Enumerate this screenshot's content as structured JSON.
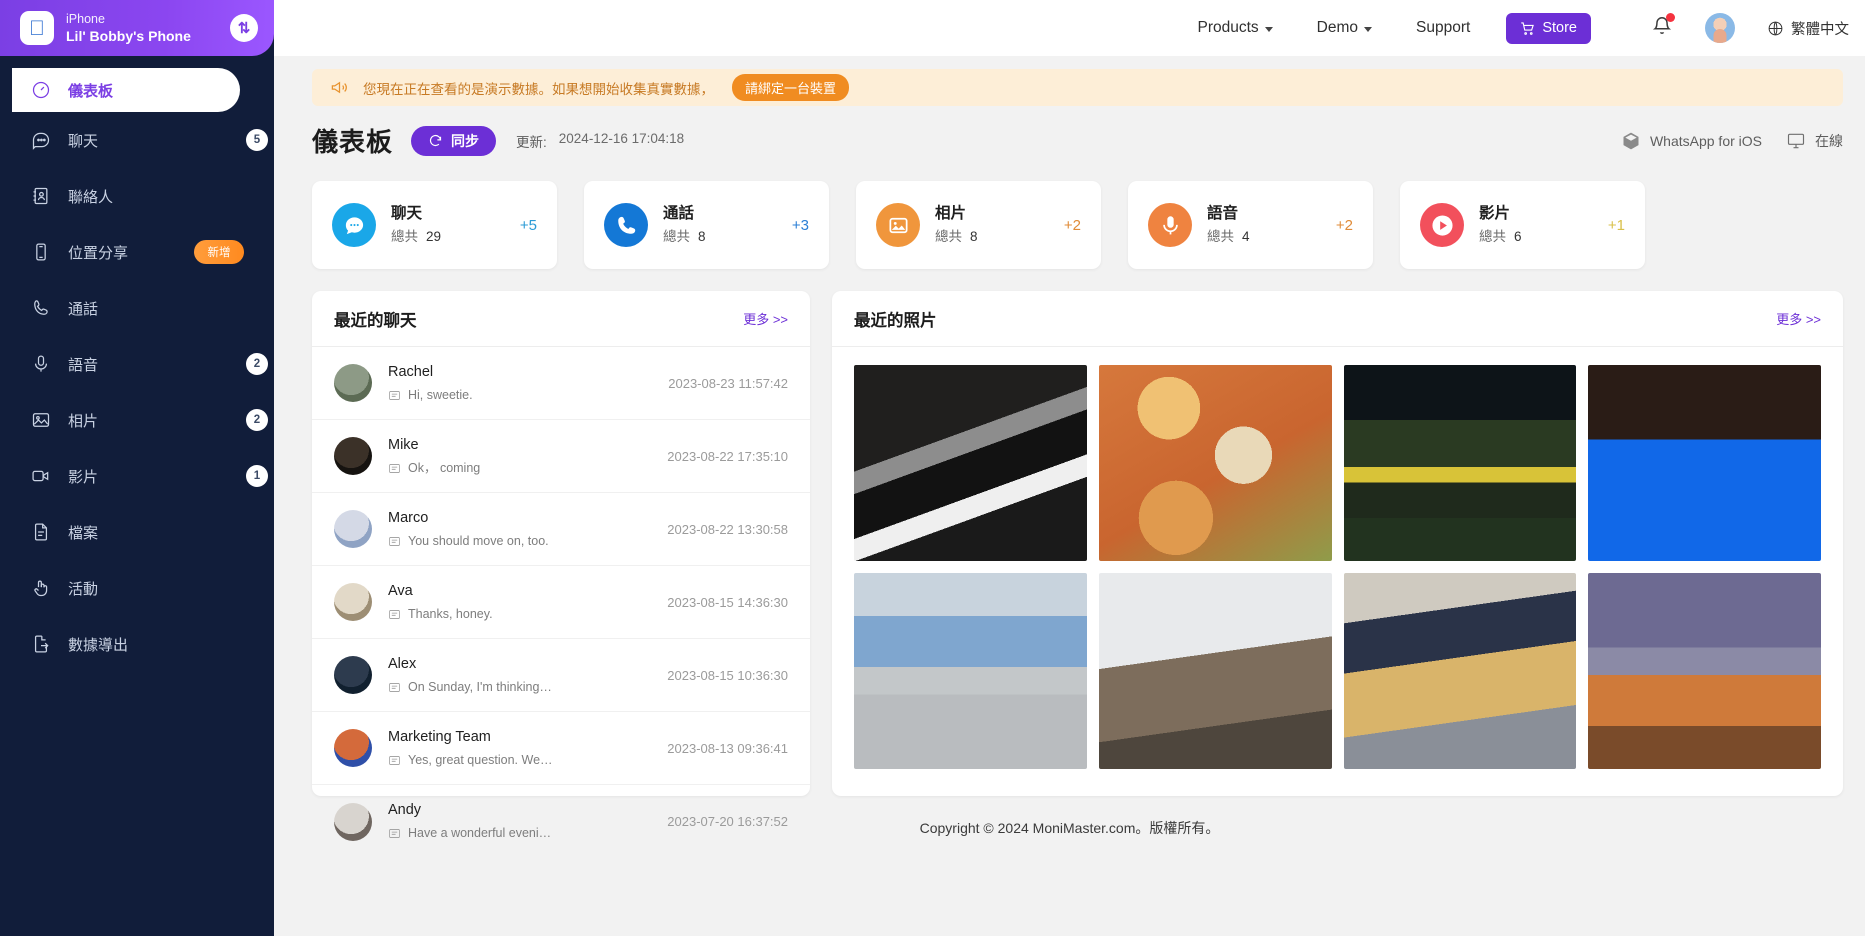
{
  "sidebar": {
    "device": {
      "platform": "iPhone",
      "name": "Lil' Bobby's Phone",
      "swap_icon": "swap-device-icon"
    },
    "items": [
      {
        "label": "儀表板",
        "icon": "dashboard-icon",
        "badge": "",
        "active": true
      },
      {
        "label": "聊天",
        "icon": "chat-bubble-icon",
        "badge": "5",
        "active": false
      },
      {
        "label": "聯絡人",
        "icon": "contacts-icon",
        "badge": "",
        "active": false
      },
      {
        "label": "位置分享",
        "icon": "phone-location-icon",
        "badge": "新增",
        "badge_type": "new",
        "active": false
      },
      {
        "label": "通話",
        "icon": "phone-call-icon",
        "badge": "",
        "active": false
      },
      {
        "label": "語音",
        "icon": "microphone-icon",
        "badge": "2",
        "active": false
      },
      {
        "label": "相片",
        "icon": "photo-icon",
        "badge": "2",
        "active": false
      },
      {
        "label": "影片",
        "icon": "video-camera-icon",
        "badge": "1",
        "active": false
      },
      {
        "label": "檔案",
        "icon": "file-icon",
        "badge": "",
        "active": false
      },
      {
        "label": "活動",
        "icon": "hand-pointer-icon",
        "badge": "",
        "active": false
      },
      {
        "label": "數據導出",
        "icon": "data-export-icon",
        "badge": "",
        "active": false
      }
    ]
  },
  "topnav": {
    "links": [
      {
        "label": "Products",
        "has_caret": true
      },
      {
        "label": "Demo",
        "has_caret": true
      },
      {
        "label": "Support",
        "has_caret": false
      }
    ],
    "store_label": "Store",
    "store_icon": "shopping-cart-icon",
    "bell_icon": "notification-bell-icon",
    "avatar_icon": "user-avatar",
    "lang_icon": "globe-icon",
    "lang_label": "繁體中文"
  },
  "notice": {
    "icon": "megaphone-icon",
    "text": "您現在正在查看的是演示數據。如果想開始收集真實數據，",
    "cta": "請綁定一台裝置"
  },
  "page": {
    "title": "儀表板",
    "sync_label": "同步",
    "sync_icon": "refresh-icon",
    "updated_label": "更新:",
    "updated_value": "2024-12-16 17:04:18",
    "app_icon": "cube-icon",
    "app_label": "WhatsApp for iOS",
    "status_icon": "monitor-icon",
    "status_label": "在線"
  },
  "stats": [
    {
      "name": "聊天",
      "total_label": "總共",
      "total": "29",
      "delta": "+5",
      "icon": "chat-bubble-icon",
      "color": "#1aa7e8",
      "delta_color": "#2b9bd6"
    },
    {
      "name": "通話",
      "total_label": "總共",
      "total": "8",
      "delta": "+3",
      "icon": "phone-call-icon",
      "color": "#1478d6",
      "delta_color": "#2b7fd6"
    },
    {
      "name": "相片",
      "total_label": "總共",
      "total": "8",
      "delta": "+2",
      "icon": "photo-icon",
      "color": "#f0963c",
      "delta_color": "#e08b38"
    },
    {
      "name": "語音",
      "total_label": "總共",
      "total": "4",
      "delta": "+2",
      "icon": "microphone-icon",
      "color": "#ef8340",
      "delta_color": "#e08b38"
    },
    {
      "name": "影片",
      "total_label": "總共",
      "total": "6",
      "delta": "+1",
      "icon": "play-icon",
      "color": "#f2505c",
      "delta_color": "#d9c14a"
    }
  ],
  "chats_panel": {
    "title": "最近的聊天",
    "more": "更多 >>",
    "rows": [
      {
        "name": "Rachel",
        "message": "Hi, sweetie.",
        "time": "2023-08-23 11:57:42",
        "avatar_colors": [
          "#8d9a86",
          "#5c6b54"
        ]
      },
      {
        "name": "Mike",
        "message": "Ok， coming",
        "time": "2023-08-22 17:35:10",
        "avatar_colors": [
          "#3b3128",
          "#161310"
        ]
      },
      {
        "name": "Marco",
        "message": "You should move on, too.",
        "time": "2023-08-22 13:30:58",
        "avatar_colors": [
          "#d4d9e6",
          "#8fa3c4"
        ]
      },
      {
        "name": "Ava",
        "message": "Thanks, honey.",
        "time": "2023-08-15 14:36:30",
        "avatar_colors": [
          "#e2d9c8",
          "#9d8e74"
        ]
      },
      {
        "name": "Alex",
        "message": "On Sunday, I'm thinking…",
        "time": "2023-08-15 10:36:30",
        "avatar_colors": [
          "#2d3b4e",
          "#11202f"
        ]
      },
      {
        "name": "Marketing Team",
        "message": "Yes, great question. We…",
        "time": "2023-08-13 09:36:41",
        "avatar_colors": [
          "#d46a3b",
          "#2f4fa8"
        ]
      },
      {
        "name": "Andy",
        "message": "Have a wonderful eveni…",
        "time": "2023-07-20 16:37:52",
        "avatar_colors": [
          "#d8d4cf",
          "#6f6660"
        ]
      }
    ]
  },
  "photos_panel": {
    "title": "最近的照片",
    "more": "更多 >>",
    "photos": [
      {
        "alt": "chessboard-pieces",
        "style": "chess"
      },
      {
        "alt": "food-bowls-table",
        "style": "food"
      },
      {
        "alt": "city-street-night",
        "style": "city"
      },
      {
        "alt": "dark-blue-blur",
        "style": "blue"
      },
      {
        "alt": "bus-stop-street",
        "style": "busstop"
      },
      {
        "alt": "mountain-hillside",
        "style": "mountain"
      },
      {
        "alt": "person-blonde-hair",
        "style": "person"
      },
      {
        "alt": "palm-trees-beach",
        "style": "palms"
      }
    ]
  },
  "footer": {
    "text": "Copyright © 2024 MoniMaster.com。版權所有。"
  }
}
